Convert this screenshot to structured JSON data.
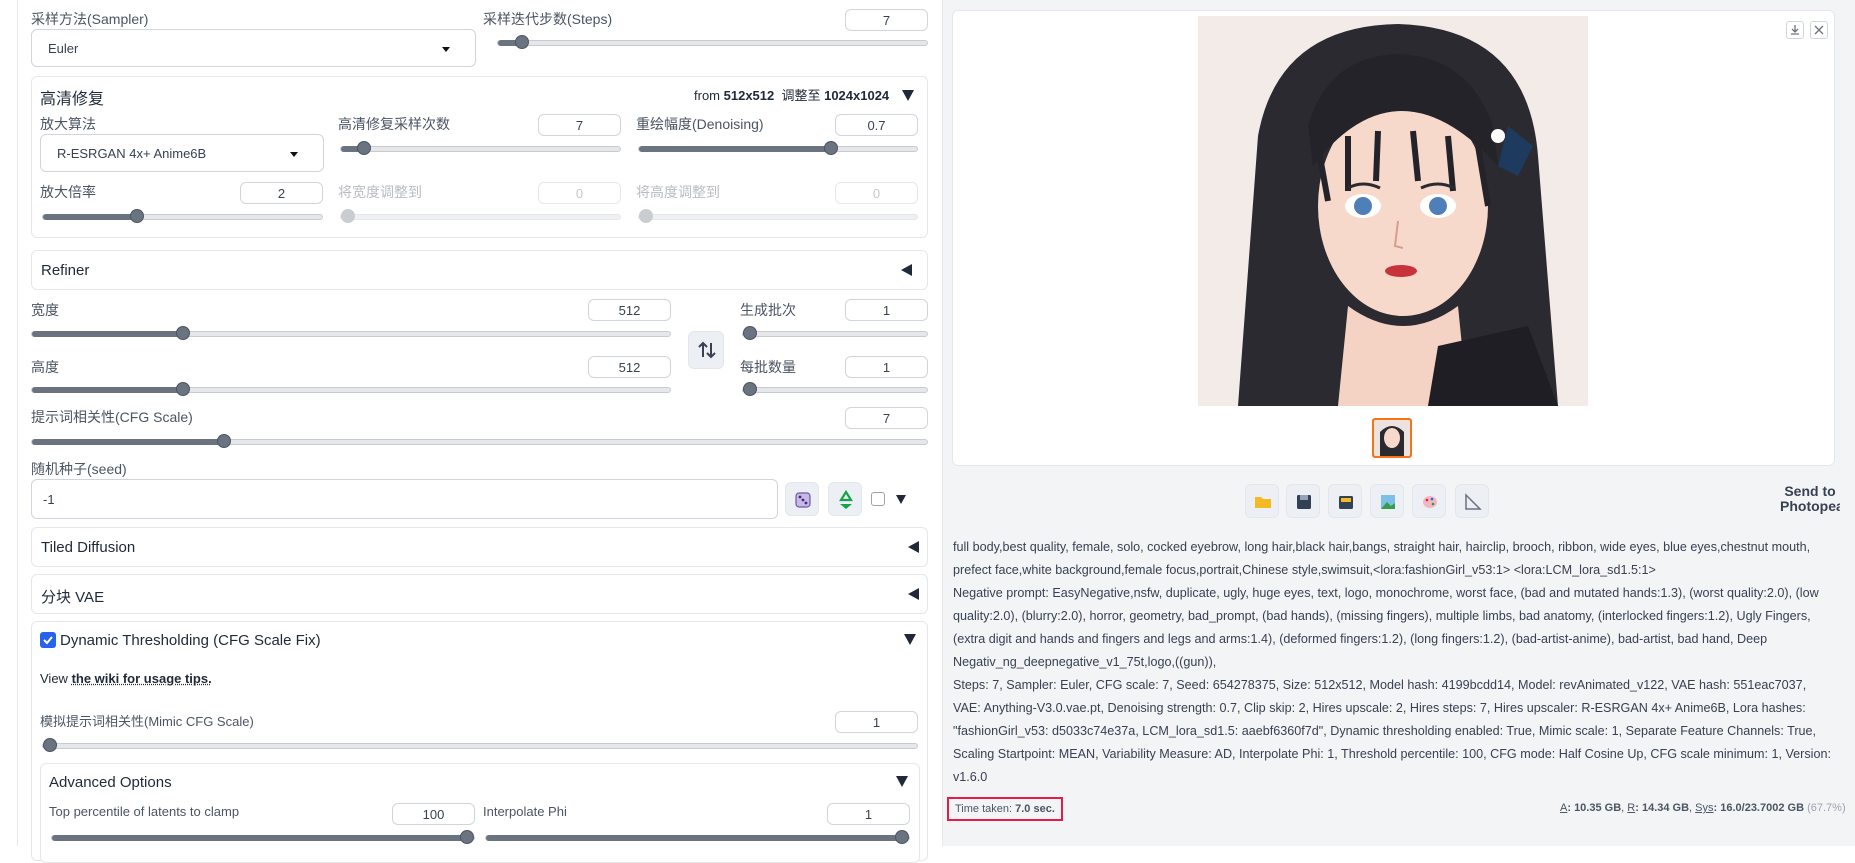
{
  "sampler": {
    "label": "采样方法(Sampler)",
    "value": "Euler"
  },
  "steps": {
    "label": "采样迭代步数(Steps)",
    "value": "7",
    "fraction": 0.04
  },
  "hires": {
    "title": "高清修复",
    "info_prefix": "from ",
    "info_from": "512x512",
    "info_mid": "  调整至 ",
    "info_to": "1024x1024",
    "upscaler": {
      "label": "放大算法",
      "value": "R-ESRGAN 4x+ Anime6B"
    },
    "hires_steps": {
      "label": "高清修复采样次数",
      "value": "7",
      "fraction": 0.06
    },
    "denoising": {
      "label": "重绘幅度(Denoising)",
      "value": "0.7",
      "fraction": 0.7
    },
    "scale": {
      "label": "放大倍率",
      "value": "2",
      "fraction": 0.33
    },
    "resize_w": {
      "label": "将宽度调整到",
      "value": "0",
      "fraction": 0
    },
    "resize_h": {
      "label": "将高度调整到",
      "value": "0",
      "fraction": 0
    }
  },
  "refiner": {
    "title": "Refiner"
  },
  "width": {
    "label": "宽度",
    "value": "512",
    "fraction": 0.23
  },
  "height": {
    "label": "高度",
    "value": "512",
    "fraction": 0.23
  },
  "batch_count": {
    "label": "生成批次",
    "value": "1",
    "fraction": 0
  },
  "batch_size": {
    "label": "每批数量",
    "value": "1",
    "fraction": 0
  },
  "swap_icon": "swap-vertical-icon",
  "cfg": {
    "label": "提示词相关性(CFG Scale)",
    "value": "7",
    "fraction": 0.21
  },
  "seed": {
    "label": "随机种子(seed)",
    "value": "-1"
  },
  "tiled_diffusion": {
    "title": "Tiled Diffusion"
  },
  "tiled_vae": {
    "title": "分块 VAE"
  },
  "dynthres": {
    "title": "Dynamic Thresholding (CFG Scale Fix)",
    "checked": true,
    "view_text": "View ",
    "wiki_link": "the wiki for usage tips.",
    "mimic": {
      "label": "模拟提示词相关性(Mimic CFG Scale)",
      "value": "1",
      "fraction": 0
    },
    "advanced": {
      "title": "Advanced Options",
      "top_percentile": {
        "label": "Top percentile of latents to clamp",
        "value": "100",
        "fraction": 1.0
      },
      "interpolate_phi": {
        "label": "Interpolate Phi",
        "value": "1",
        "fraction": 1.0
      }
    }
  },
  "gallery": {
    "download_icon": "download-icon",
    "close_icon": "close-icon",
    "thumbnail_count": 1
  },
  "toolbar": {
    "buttons": [
      "folder-icon",
      "save-icon",
      "zip-icon",
      "image-icon",
      "palette-icon",
      "ruler-icon"
    ],
    "send_to_photopea": "Send to Photopea"
  },
  "generation_info": {
    "prompt": "full body,best quality, female, solo, cocked eyebrow, long hair,black hair,bangs, straight hair, hairclip, brooch, ribbon, wide eyes, blue eyes,chestnut mouth, prefect face,white background,female focus,portrait,Chinese style,swimsuit,<lora:fashionGirl_v53:1> <lora:LCM_lora_sd1.5:1>",
    "negative": "Negative prompt: EasyNegative,nsfw, duplicate, ugly, huge eyes, text, logo, monochrome, worst face, (bad and mutated hands:1.3), (worst quality:2.0), (low quality:2.0), (blurry:2.0), horror, geometry, bad_prompt, (bad hands), (missing fingers), multiple limbs, bad anatomy, (interlocked fingers:1.2), Ugly Fingers, (extra digit and hands and fingers and legs and arms:1.4), (deformed fingers:1.2), (long fingers:1.2), (bad-artist-anime), bad-artist, bad hand, Deep Negativ_ng_deepnegative_v1_75t,logo,((gun)),",
    "params": "Steps: 7, Sampler: Euler, CFG scale: 7, Seed: 654278375, Size: 512x512, Model hash: 4199bcdd14, Model: revAnimated_v122, VAE hash: 551eac7037, VAE: Anything-V3.0.vae.pt, Denoising strength: 0.7, Clip skip: 2, Hires upscale: 2, Hires steps: 7, Hires upscaler: R-ESRGAN 4x+ Anime6B, Lora hashes: \"fashionGirl_v53: d5033c74e37a, LCM_lora_sd1.5: aaebf6360f7d\", Dynamic thresholding enabled: True, Mimic scale: 1, Separate Feature Channels: True, Scaling Startpoint: MEAN, Variability Measure: AD, Interpolate Phi: 1, Threshold percentile: 100, CFG mode: Half Cosine Up, CFG scale minimum: 1, Version: v1.6.0"
  },
  "footer": {
    "time_label": "Time taken: ",
    "time_value": "7.0 sec.",
    "mem_a_label": "A",
    "mem_a_value": ": 10.35 GB",
    "mem_r_label": "R",
    "mem_r_value": ": 14.34 GB",
    "mem_sys_label": "Sys",
    "mem_sys_value": ": 16.0/23.7002 GB",
    "mem_pct": " (67.7%)"
  },
  "colors": {
    "accent": "#2563eb",
    "highlight_border": "#e11d48",
    "thumb_border": "#f97316"
  }
}
